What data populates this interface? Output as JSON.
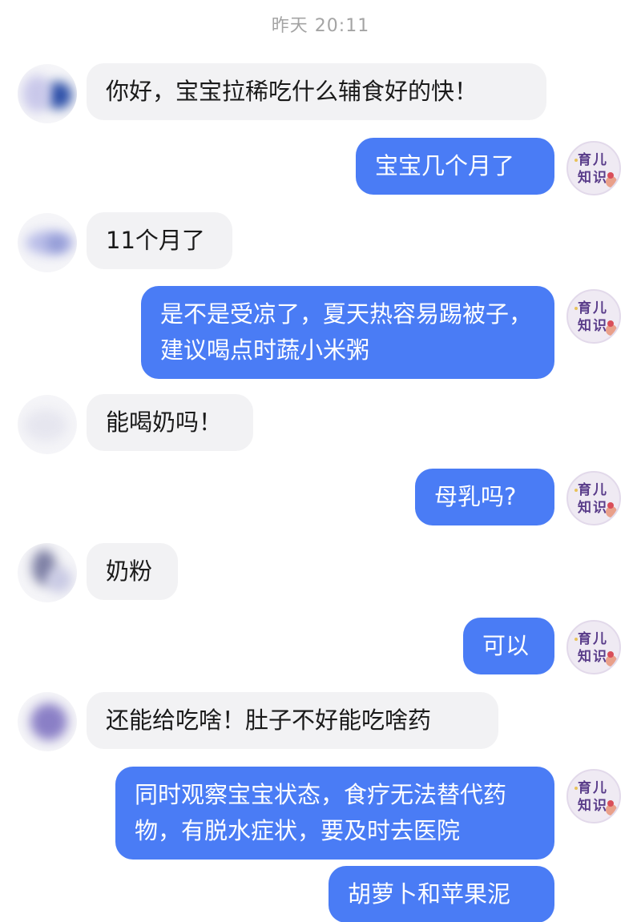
{
  "header": {
    "timestamp": "昨天 20:11"
  },
  "brand_avatar": {
    "line1": "育儿",
    "line2": "知识"
  },
  "messages": [
    {
      "side": "in",
      "text": "你好，宝宝拉稀吃什么辅食好的快！"
    },
    {
      "side": "out",
      "text": "宝宝几个月了"
    },
    {
      "side": "in",
      "text": "11个月了"
    },
    {
      "side": "out",
      "text": "是不是受凉了，夏天热容易踢被子，建议喝点时蔬小米粥"
    },
    {
      "side": "in",
      "text": "能喝奶吗！"
    },
    {
      "side": "out",
      "text": "母乳吗?"
    },
    {
      "side": "in",
      "text": "奶粉"
    },
    {
      "side": "out",
      "text": "可以"
    },
    {
      "side": "in",
      "text": "还能给吃啥！肚子不好能吃啥药"
    },
    {
      "side": "out",
      "text": "同时观察宝宝状态，食疗无法替代药物，有脱水症状，要及时去医院"
    },
    {
      "side": "out",
      "text": "胡萝卜和苹果泥"
    }
  ],
  "colors": {
    "outgoing_bubble": "#4a7cf5",
    "incoming_bubble": "#f2f2f4",
    "timestamp": "#a4a4a4"
  }
}
